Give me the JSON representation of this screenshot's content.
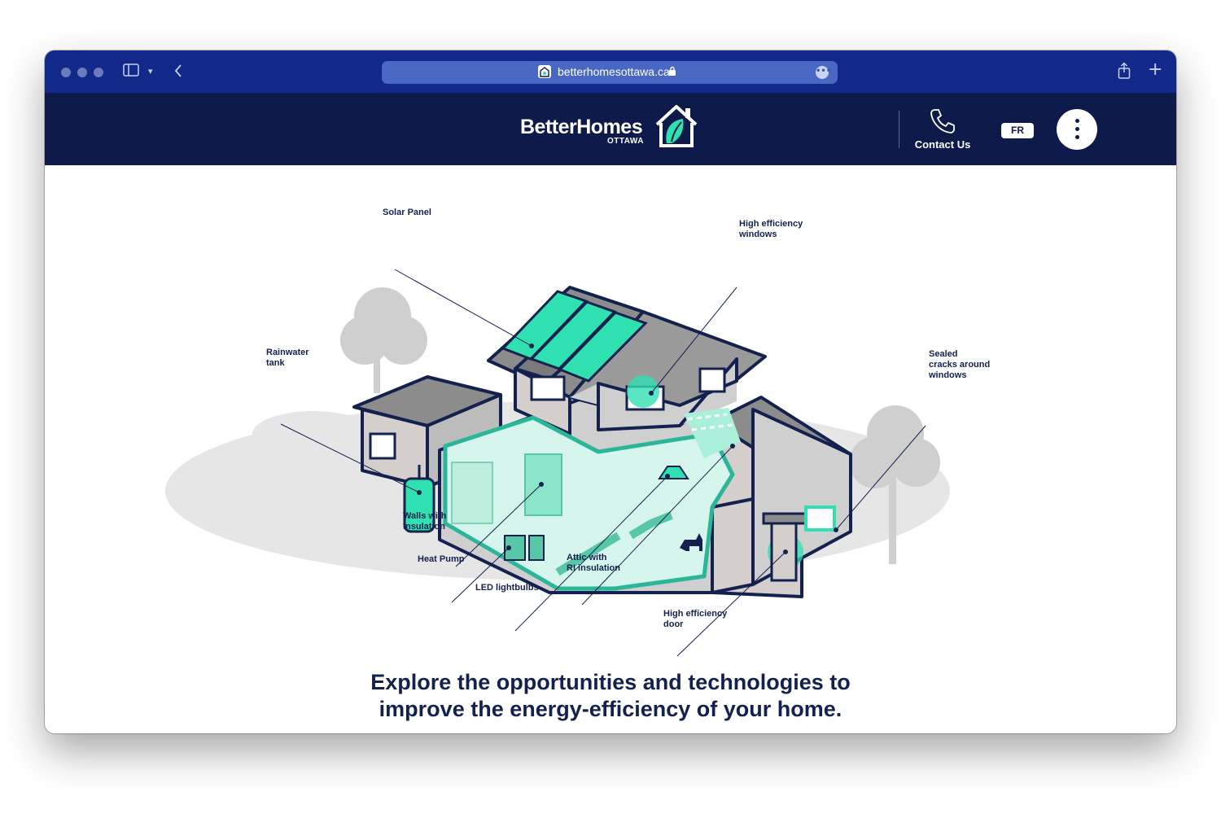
{
  "browser": {
    "url": "betterhomesottawa.ca"
  },
  "header": {
    "logo_word": "BetterHomes",
    "logo_sub": "OTTAWA",
    "contact_label": "Contact Us",
    "lang_label": "FR"
  },
  "labels": {
    "solar_panel": "Solar Panel",
    "high_eff_windows": "High efficiency\nwindows",
    "rainwater_tank": "Rainwater\ntank",
    "sealed_cracks": "Sealed\ncracks around\nwindows",
    "walls_insulation": "Walls with\ninsulation",
    "heat_pump": "Heat Pump",
    "led_lightbulbs": "LED lightbulbs",
    "attic_insulation": "Attic with\nRI insulation",
    "high_eff_door": "High efficiency\ndoor"
  },
  "main": {
    "headline_line1": "Explore the opportunities and technologies to",
    "headline_line2": "improve the energy-efficiency of your home."
  },
  "colors": {
    "chrome": "#13298a",
    "header": "#0d1a4a",
    "accent": "#2fe0b0",
    "text": "#14214f"
  }
}
